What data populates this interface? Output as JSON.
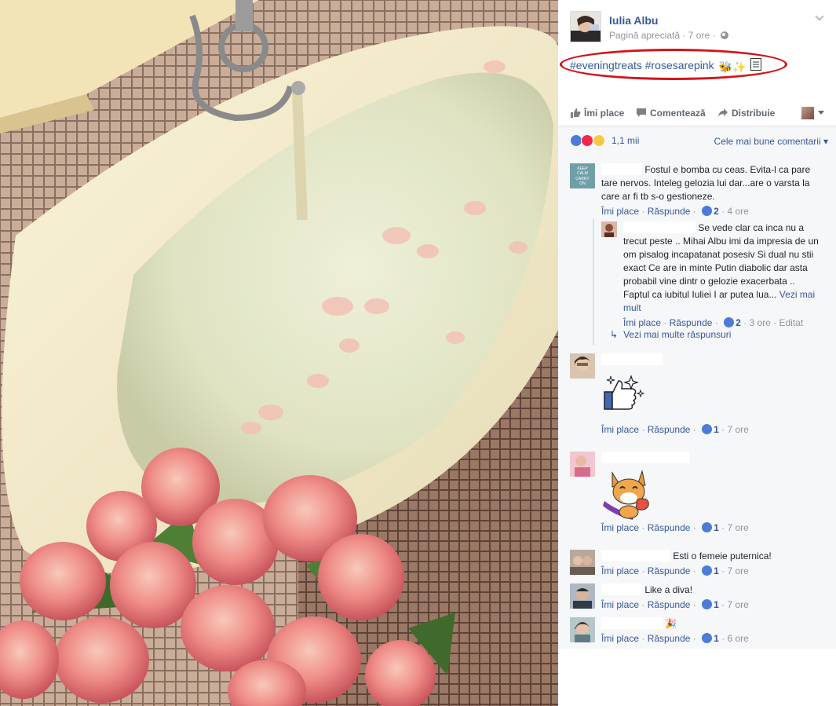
{
  "post": {
    "author": "Iulia Albu",
    "page_type": "Pagină apreciată",
    "time": "7 ore",
    "text_hashtag1": "#eveningtreats",
    "text_hashtag2": "#rosesarepink",
    "text_emoji": "🐝✨"
  },
  "actions": {
    "like": "Îmi place",
    "comment": "Comentează",
    "share": "Distribuie"
  },
  "reactions": {
    "types": [
      "like",
      "love",
      "wow"
    ],
    "count": "1,1 mii",
    "sort_label": "Cele mai bune comentarii"
  },
  "comments": [
    {
      "text": "Fostul e bomba cu ceas. Evita-l ca pare tare nervos. Inteleg gelozia lui dar...are o varsta la care ar fi tb s-o gestioneze.",
      "avatar_text": "KEEP CALM AND CARRY ON",
      "likes": "2",
      "time": "4 ore"
    },
    {
      "text": "Se vede clar ca inca nu a trecut peste .. Mihai Albu imi da impresia de un om pisalog incapatanat posesiv Si dual nu stii exact Ce are in minte Putin diabolic dar asta probabil vine dintr o gelozie exacerbata .. Faptul ca iubitul Iuliei I ar putea lua...",
      "see_more": "Vezi mai mult",
      "likes": "2",
      "time": "3 ore",
      "edited": "Editat"
    },
    {
      "sticker": "thumbs-up-sparkles",
      "likes": "1",
      "time": "7 ore"
    },
    {
      "sticker": "corgi-heart",
      "likes": "1",
      "time": "7 ore"
    },
    {
      "text": "Esti o femeie puternica!",
      "likes": "1",
      "time": "7 ore"
    },
    {
      "text": "Like a diva!",
      "likes": "1",
      "time": "7 ore"
    },
    {
      "text": "🎉",
      "likes": "1",
      "time": "6 ore"
    }
  ],
  "comment_links": {
    "like": "Îmi place",
    "reply": "Răspunde"
  },
  "more_replies": "Vezi mai multe răspunsuri",
  "colors": {
    "link": "#365899",
    "grey": "#90949c",
    "highlight_ellipse": "#d3131a"
  }
}
